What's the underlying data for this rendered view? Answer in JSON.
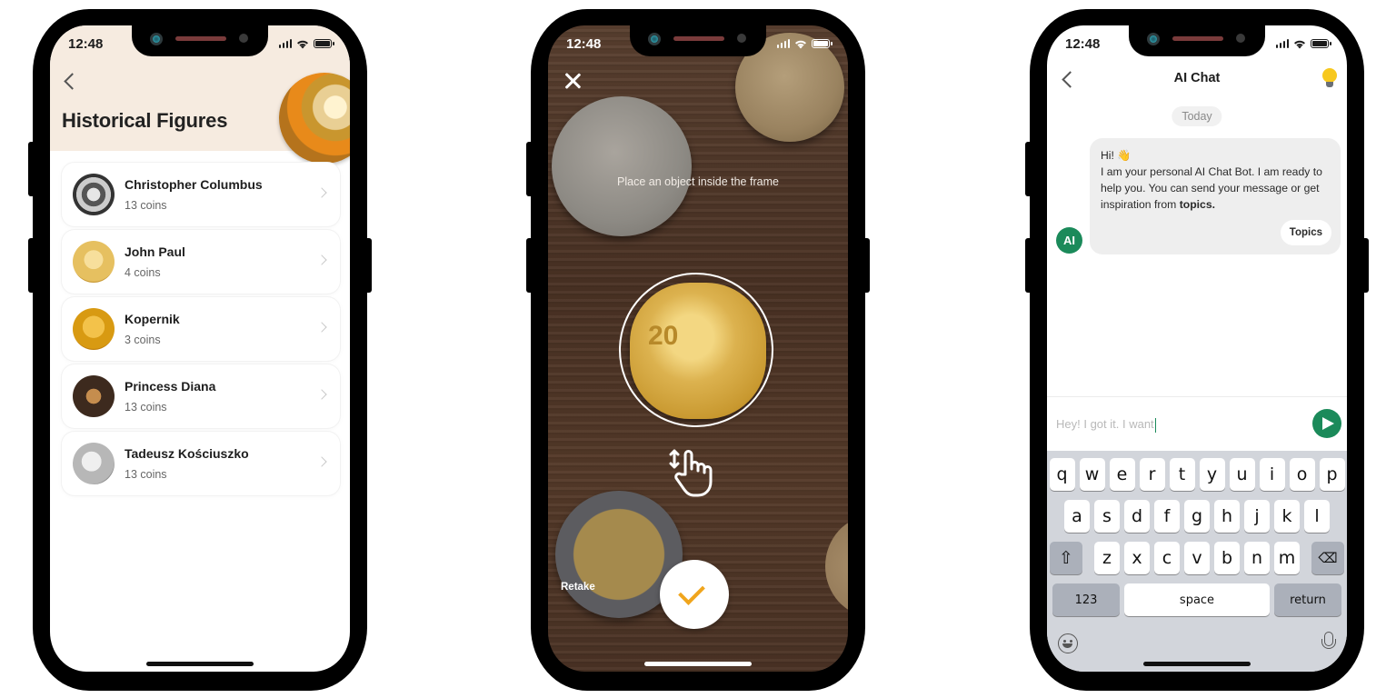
{
  "status_bar": {
    "time": "12:48"
  },
  "screen1": {
    "title": "Historical Figures",
    "items": [
      {
        "name": "Christopher Columbus",
        "count": "13 coins",
        "coin": "silver-dark"
      },
      {
        "name": "John Paul",
        "count": "4 coins",
        "coin": "gold-light"
      },
      {
        "name": "Kopernik",
        "count": "3 coins",
        "coin": "gold"
      },
      {
        "name": "Princess Diana",
        "count": "13 coins",
        "coin": "bronze"
      },
      {
        "name": "Tadeusz Kościuszko",
        "count": "13 coins",
        "coin": "silver"
      }
    ]
  },
  "screen2": {
    "hint": "Place an object inside the frame",
    "coin_label": "20",
    "retake_label": "Retake",
    "accent": "#f0a51c"
  },
  "screen3": {
    "title": "AI Chat",
    "date_chip": "Today",
    "message_greeting": "Hi! 👋",
    "message_body": "I am your personal AI Chat Bot. I am ready to help you. You can send your message or get inspiration from ",
    "message_bold": "topics.",
    "topics_button": "Topics",
    "avatar_label": "AI",
    "input_value": "Hey! I got it. I want",
    "accent": "#1b8a5a",
    "keyboard": {
      "row1": [
        "q",
        "w",
        "e",
        "r",
        "t",
        "y",
        "u",
        "i",
        "o",
        "p"
      ],
      "row2": [
        "a",
        "s",
        "d",
        "f",
        "g",
        "h",
        "j",
        "k",
        "l"
      ],
      "row3": [
        "z",
        "x",
        "c",
        "v",
        "b",
        "n",
        "m"
      ],
      "numbers_key": "123",
      "space_key": "space",
      "return_key": "return"
    }
  }
}
